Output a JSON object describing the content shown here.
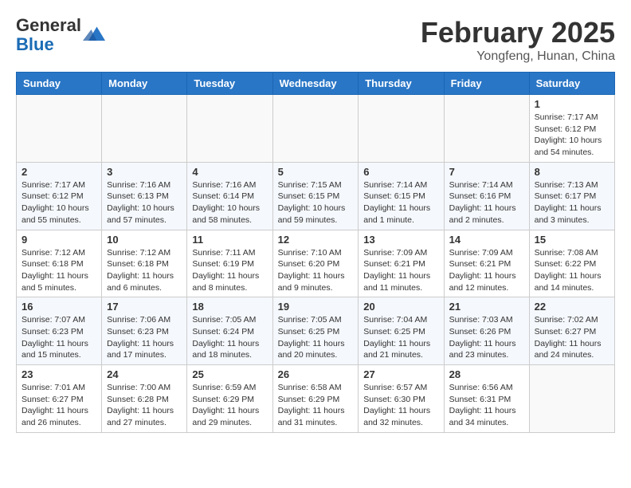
{
  "logo": {
    "general": "General",
    "blue": "Blue"
  },
  "header": {
    "month": "February 2025",
    "location": "Yongfeng, Hunan, China"
  },
  "weekdays": [
    "Sunday",
    "Monday",
    "Tuesday",
    "Wednesday",
    "Thursday",
    "Friday",
    "Saturday"
  ],
  "weeks": [
    [
      {
        "day": "",
        "info": ""
      },
      {
        "day": "",
        "info": ""
      },
      {
        "day": "",
        "info": ""
      },
      {
        "day": "",
        "info": ""
      },
      {
        "day": "",
        "info": ""
      },
      {
        "day": "",
        "info": ""
      },
      {
        "day": "1",
        "info": "Sunrise: 7:17 AM\nSunset: 6:12 PM\nDaylight: 10 hours\nand 54 minutes."
      }
    ],
    [
      {
        "day": "2",
        "info": "Sunrise: 7:17 AM\nSunset: 6:12 PM\nDaylight: 10 hours\nand 55 minutes."
      },
      {
        "day": "3",
        "info": "Sunrise: 7:16 AM\nSunset: 6:13 PM\nDaylight: 10 hours\nand 57 minutes."
      },
      {
        "day": "4",
        "info": "Sunrise: 7:16 AM\nSunset: 6:14 PM\nDaylight: 10 hours\nand 58 minutes."
      },
      {
        "day": "5",
        "info": "Sunrise: 7:15 AM\nSunset: 6:15 PM\nDaylight: 10 hours\nand 59 minutes."
      },
      {
        "day": "6",
        "info": "Sunrise: 7:14 AM\nSunset: 6:15 PM\nDaylight: 11 hours\nand 1 minute."
      },
      {
        "day": "7",
        "info": "Sunrise: 7:14 AM\nSunset: 6:16 PM\nDaylight: 11 hours\nand 2 minutes."
      },
      {
        "day": "8",
        "info": "Sunrise: 7:13 AM\nSunset: 6:17 PM\nDaylight: 11 hours\nand 3 minutes."
      }
    ],
    [
      {
        "day": "9",
        "info": "Sunrise: 7:12 AM\nSunset: 6:18 PM\nDaylight: 11 hours\nand 5 minutes."
      },
      {
        "day": "10",
        "info": "Sunrise: 7:12 AM\nSunset: 6:18 PM\nDaylight: 11 hours\nand 6 minutes."
      },
      {
        "day": "11",
        "info": "Sunrise: 7:11 AM\nSunset: 6:19 PM\nDaylight: 11 hours\nand 8 minutes."
      },
      {
        "day": "12",
        "info": "Sunrise: 7:10 AM\nSunset: 6:20 PM\nDaylight: 11 hours\nand 9 minutes."
      },
      {
        "day": "13",
        "info": "Sunrise: 7:09 AM\nSunset: 6:21 PM\nDaylight: 11 hours\nand 11 minutes."
      },
      {
        "day": "14",
        "info": "Sunrise: 7:09 AM\nSunset: 6:21 PM\nDaylight: 11 hours\nand 12 minutes."
      },
      {
        "day": "15",
        "info": "Sunrise: 7:08 AM\nSunset: 6:22 PM\nDaylight: 11 hours\nand 14 minutes."
      }
    ],
    [
      {
        "day": "16",
        "info": "Sunrise: 7:07 AM\nSunset: 6:23 PM\nDaylight: 11 hours\nand 15 minutes."
      },
      {
        "day": "17",
        "info": "Sunrise: 7:06 AM\nSunset: 6:23 PM\nDaylight: 11 hours\nand 17 minutes."
      },
      {
        "day": "18",
        "info": "Sunrise: 7:05 AM\nSunset: 6:24 PM\nDaylight: 11 hours\nand 18 minutes."
      },
      {
        "day": "19",
        "info": "Sunrise: 7:05 AM\nSunset: 6:25 PM\nDaylight: 11 hours\nand 20 minutes."
      },
      {
        "day": "20",
        "info": "Sunrise: 7:04 AM\nSunset: 6:25 PM\nDaylight: 11 hours\nand 21 minutes."
      },
      {
        "day": "21",
        "info": "Sunrise: 7:03 AM\nSunset: 6:26 PM\nDaylight: 11 hours\nand 23 minutes."
      },
      {
        "day": "22",
        "info": "Sunrise: 7:02 AM\nSunset: 6:27 PM\nDaylight: 11 hours\nand 24 minutes."
      }
    ],
    [
      {
        "day": "23",
        "info": "Sunrise: 7:01 AM\nSunset: 6:27 PM\nDaylight: 11 hours\nand 26 minutes."
      },
      {
        "day": "24",
        "info": "Sunrise: 7:00 AM\nSunset: 6:28 PM\nDaylight: 11 hours\nand 27 minutes."
      },
      {
        "day": "25",
        "info": "Sunrise: 6:59 AM\nSunset: 6:29 PM\nDaylight: 11 hours\nand 29 minutes."
      },
      {
        "day": "26",
        "info": "Sunrise: 6:58 AM\nSunset: 6:29 PM\nDaylight: 11 hours\nand 31 minutes."
      },
      {
        "day": "27",
        "info": "Sunrise: 6:57 AM\nSunset: 6:30 PM\nDaylight: 11 hours\nand 32 minutes."
      },
      {
        "day": "28",
        "info": "Sunrise: 6:56 AM\nSunset: 6:31 PM\nDaylight: 11 hours\nand 34 minutes."
      },
      {
        "day": "",
        "info": ""
      }
    ]
  ]
}
